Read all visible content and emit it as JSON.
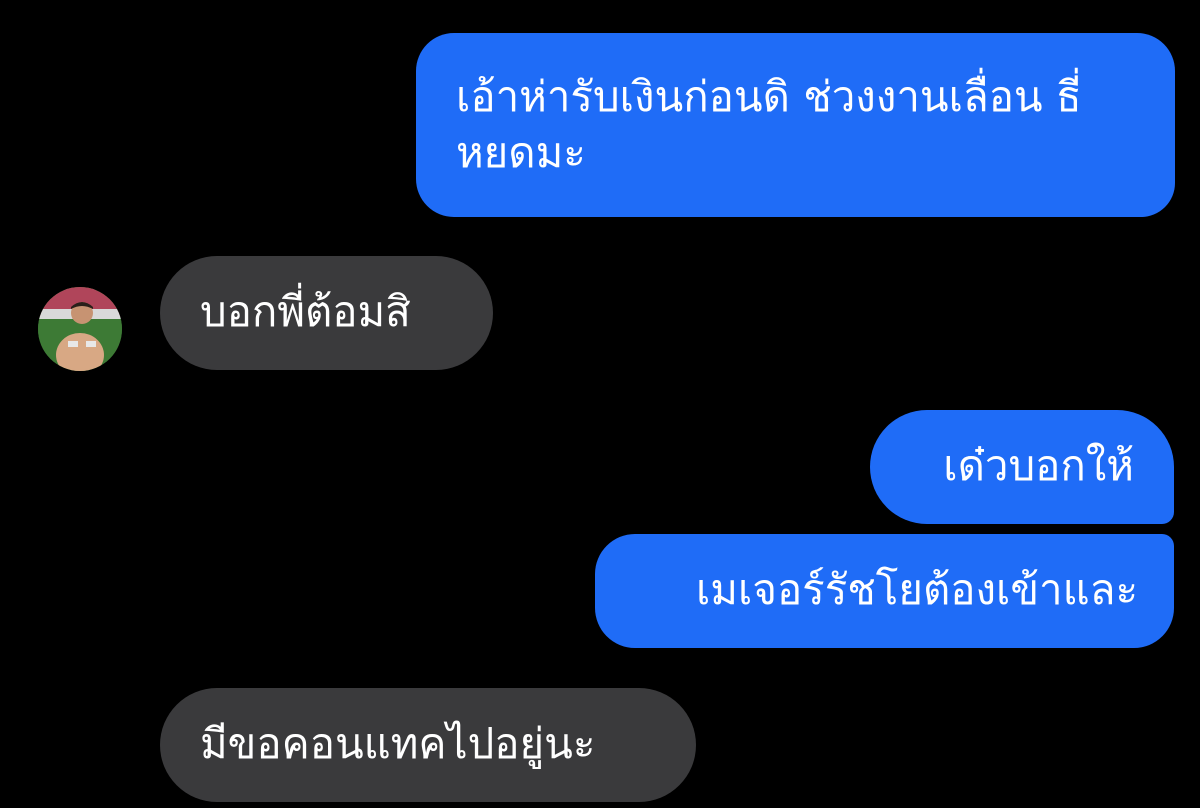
{
  "messages": [
    {
      "direction": "outgoing",
      "text": "เอ้าห่ารับเงินก่อนดิ ช่วงงานเลื่อน ธี่หยดมะ"
    },
    {
      "direction": "incoming",
      "text": "บอกพี่ต้อมสิ"
    },
    {
      "direction": "outgoing",
      "text": "เด๋วบอกให้"
    },
    {
      "direction": "outgoing",
      "text": "เมเจอร์รัชโยต้องเข้าและ"
    },
    {
      "direction": "incoming",
      "text": "มีขอคอนแทคไปอยู่นะ"
    }
  ],
  "contact": {
    "avatar_icon": "contact-avatar"
  },
  "colors": {
    "background": "#000000",
    "outgoing_bubble": "#1f6cf7",
    "incoming_bubble": "#3a3a3c",
    "text": "#ffffff"
  }
}
